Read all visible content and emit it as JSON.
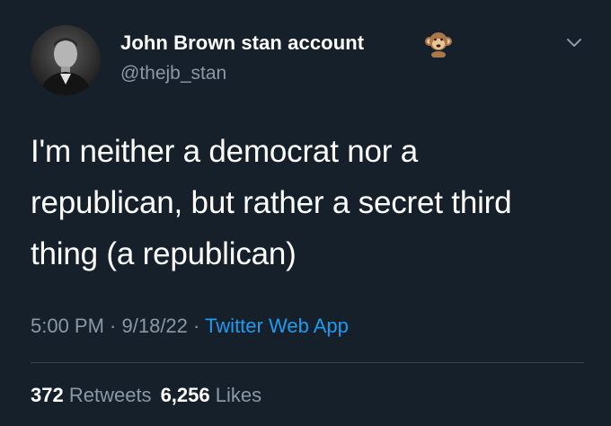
{
  "user": {
    "display_name": "John Brown stan account",
    "handle": "@thejb_stan",
    "badge_icon": "monkey-emoji"
  },
  "tweet": {
    "text": "I'm neither a democrat nor a\nrepublican, but rather a secret third\nthing (a republican)"
  },
  "meta": {
    "time": "5:00 PM",
    "sep1": " · ",
    "date": "9/18/22",
    "sep2": " · ",
    "source": "Twitter Web App"
  },
  "stats": {
    "retweets_count": "372",
    "retweets_label": "Retweets",
    "likes_count": "6,256",
    "likes_label": "Likes"
  },
  "colors": {
    "background": "#15202b",
    "primary_text": "#ffffff",
    "secondary_text": "#8b98a5",
    "link": "#1d9bf0",
    "divider": "#38444d"
  }
}
